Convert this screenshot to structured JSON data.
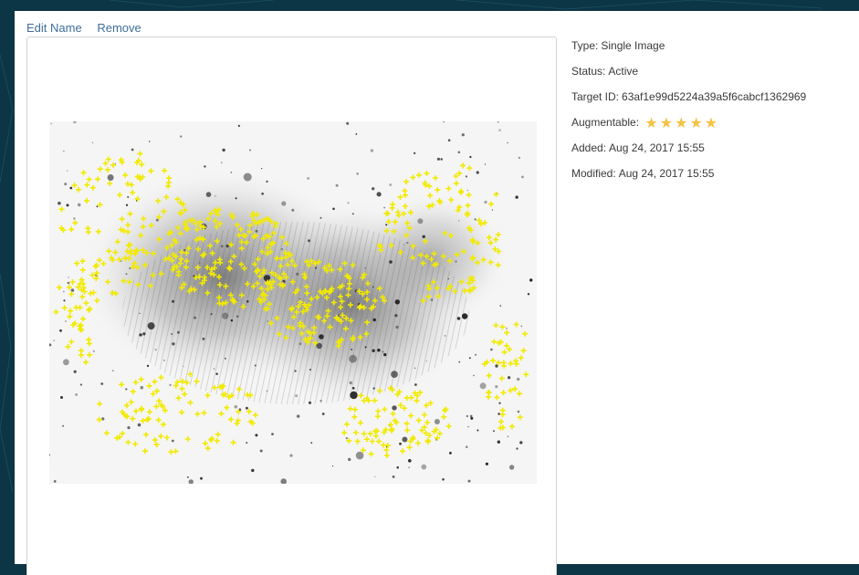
{
  "actions": {
    "edit_name": "Edit Name",
    "remove": "Remove"
  },
  "details": {
    "type_label": "Type:",
    "type_value": "Single Image",
    "status_label": "Status:",
    "status_value": "Active",
    "target_id_label": "Target ID:",
    "target_id_value": "63af1e99d5224a39a5f6cabcf1362969",
    "augmentable_label": "Augmentable:",
    "augmentable_rating": 5,
    "augmentable_max": 5,
    "added_label": "Added:",
    "added_value": "Aug 24, 2017 15:55",
    "modified_label": "Modified:",
    "modified_value": "Aug 24, 2017 15:55"
  },
  "colors": {
    "star": "#f5c243",
    "feature_marker": "#f2ea00",
    "link": "#3f6e9a",
    "page_bg": "#0c3545"
  },
  "icons": {
    "rating": "star-icon",
    "feature": "feature-point-marker"
  }
}
